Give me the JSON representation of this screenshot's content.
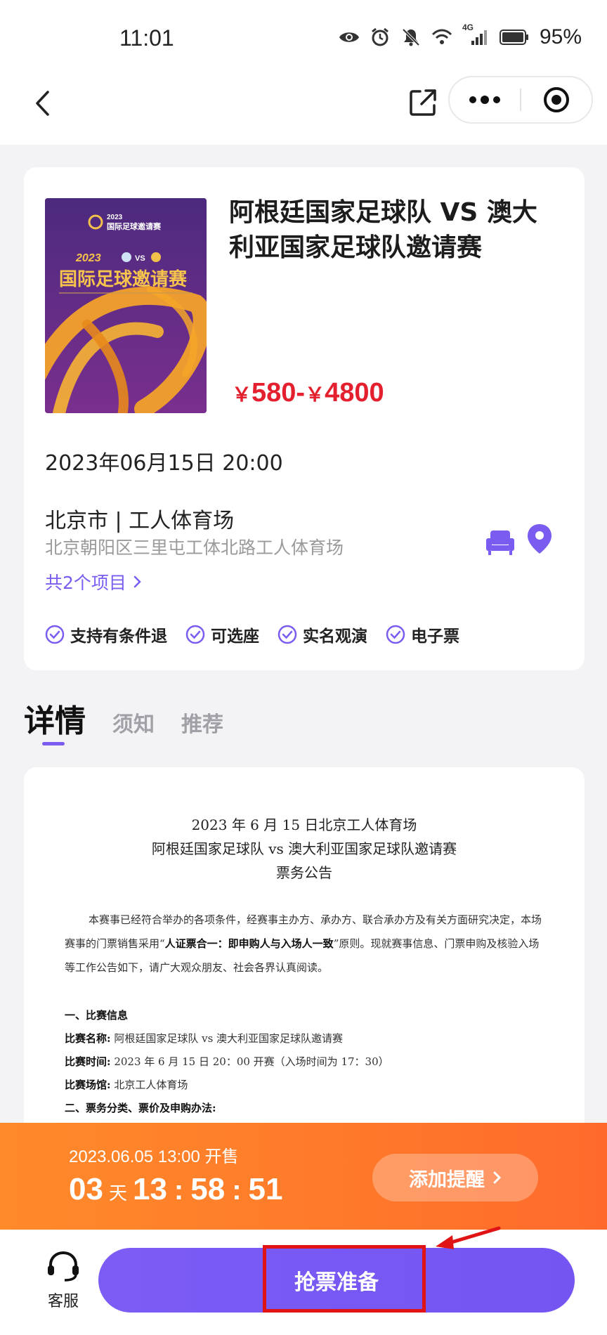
{
  "status_bar": {
    "time": "11:01",
    "battery": "95%",
    "network": "4G",
    "icons": [
      "eye-icon",
      "alarm-icon",
      "mute-icon",
      "wifi-icon",
      "signal-icon",
      "battery-icon"
    ]
  },
  "nav": {
    "icons": [
      "back-icon",
      "share-icon",
      "more-icon",
      "target-icon"
    ]
  },
  "event": {
    "title": "阿根廷国家足球队 VS 澳大利亚国家足球队邀请赛",
    "price": "580-",
    "price_max": "4800",
    "currency": "￥",
    "datetime": "2023年06月15日 20:00",
    "venue_name": "北京市 | 工人体育场",
    "venue_address": "北京朝阳区三里屯工体北路工人体育场",
    "projects_link": "共2个项目",
    "features": [
      "支持有条件退",
      "可选座",
      "实名观演",
      "电子票"
    ],
    "poster": {
      "year": "2023",
      "subtitle": "国际足球邀请赛",
      "year_main": "2023",
      "vs": "VS",
      "headline": "国际足球邀请赛"
    }
  },
  "tabs": [
    "详情",
    "须知",
    "推荐"
  ],
  "notice": {
    "title_line1": "2023 年 6 月 15 日北京工人体育场",
    "title_line2": "阿根廷国家足球队 vs 澳大利亚国家足球队邀请赛",
    "title_line3": "票务公告",
    "para1_a": "本赛事已经符合举办的各项条件，经赛事主办方、承办方、联合承办方及有关方面研究决定，本场赛事的门票销售采用“",
    "para1_bold": "人证票合一：即申购人与入场人一致",
    "para1_b": "”原则。现就赛事信息、门票申购及核验入场等工作公告如下，请广大观众朋友、社会各界认真阅读。",
    "section1": "一、比赛信息",
    "match_name_label": "比赛名称:",
    "match_name_value": "阿根廷国家足球队 vs 澳大利亚国家足球队邀请赛",
    "match_time_label": "比赛时间:",
    "match_time_value": "2023 年 6 月 15 日 20：00 开赛（入场时间为 17：30）",
    "match_venue_label": "比赛场馆:",
    "match_venue_value": "北京工人体育场",
    "section2": "二、票务分类、票价及申购办法:"
  },
  "countdown": {
    "sale_time": "2023.06.05 13:00 开售",
    "days": "03",
    "days_unit": "天",
    "hours": "13",
    "minutes": "58",
    "seconds": "51",
    "remind_label": "添加提醒"
  },
  "bottom": {
    "service_label": "客服",
    "buy_label": "抢票准备"
  },
  "colors": {
    "accent": "#7b5cf0",
    "price": "#e4202f",
    "countdown_bg": "#ff7a2a",
    "annotation": "#e01414"
  }
}
